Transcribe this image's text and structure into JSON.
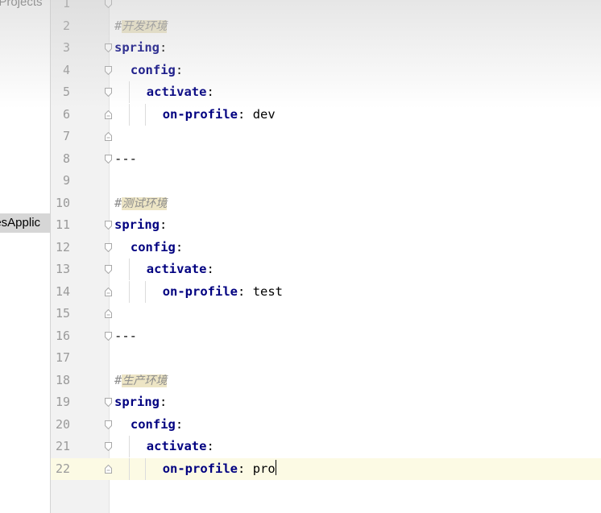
{
  "project_panel": {
    "projects_label": "nProjects",
    "app_item_label": "lesApplic"
  },
  "editor": {
    "lines": [
      {
        "n": "1",
        "kind": "blank"
      },
      {
        "n": "2",
        "kind": "comment",
        "hash": "#",
        "text": "开发环境"
      },
      {
        "n": "3",
        "kind": "key",
        "indent": 0,
        "key": "spring",
        "sep": ":",
        "value": ""
      },
      {
        "n": "4",
        "kind": "key",
        "indent": 1,
        "key": "config",
        "sep": ":",
        "value": ""
      },
      {
        "n": "5",
        "kind": "key",
        "indent": 2,
        "key": "activate",
        "sep": ":",
        "value": ""
      },
      {
        "n": "6",
        "kind": "key",
        "indent": 3,
        "key": "on-profile",
        "sep": ": ",
        "value": "dev"
      },
      {
        "n": "7",
        "kind": "blank"
      },
      {
        "n": "8",
        "kind": "sep",
        "text": "---"
      },
      {
        "n": "9",
        "kind": "blank"
      },
      {
        "n": "10",
        "kind": "comment",
        "hash": "#",
        "text": "测试环境"
      },
      {
        "n": "11",
        "kind": "key",
        "indent": 0,
        "key": "spring",
        "sep": ":",
        "value": ""
      },
      {
        "n": "12",
        "kind": "key",
        "indent": 1,
        "key": "config",
        "sep": ":",
        "value": ""
      },
      {
        "n": "13",
        "kind": "key",
        "indent": 2,
        "key": "activate",
        "sep": ":",
        "value": ""
      },
      {
        "n": "14",
        "kind": "key",
        "indent": 3,
        "key": "on-profile",
        "sep": ": ",
        "value": "test"
      },
      {
        "n": "15",
        "kind": "blank"
      },
      {
        "n": "16",
        "kind": "sep",
        "text": "---"
      },
      {
        "n": "17",
        "kind": "blank"
      },
      {
        "n": "18",
        "kind": "comment",
        "hash": "#",
        "text": "生产环境"
      },
      {
        "n": "19",
        "kind": "key",
        "indent": 0,
        "key": "spring",
        "sep": ":",
        "value": ""
      },
      {
        "n": "20",
        "kind": "key",
        "indent": 1,
        "key": "config",
        "sep": ":",
        "value": ""
      },
      {
        "n": "21",
        "kind": "key",
        "indent": 2,
        "key": "activate",
        "sep": ":",
        "value": ""
      },
      {
        "n": "22",
        "kind": "key",
        "indent": 3,
        "key": "on-profile",
        "sep": ": ",
        "value": "pro",
        "current": true
      }
    ]
  },
  "colors": {
    "key": "#000080",
    "comment": "#8c8c8c",
    "comment_bg": "#ede5c5",
    "current_line": "#fcfae4",
    "gutter": "#f2f2f2"
  }
}
